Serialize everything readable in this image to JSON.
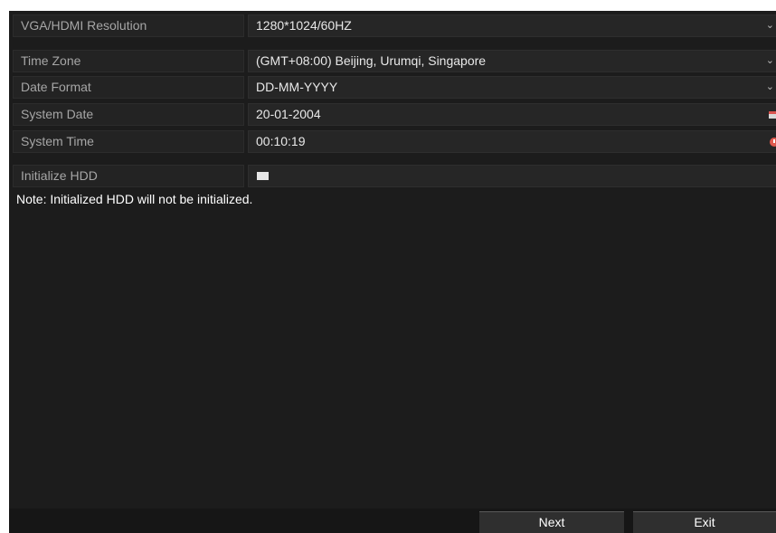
{
  "settings": {
    "resolution": {
      "label": "VGA/HDMI Resolution",
      "value": "1280*1024/60HZ"
    },
    "time_zone": {
      "label": "Time Zone",
      "value": "(GMT+08:00) Beijing, Urumqi, Singapore"
    },
    "date_format": {
      "label": "Date Format",
      "value": "DD-MM-YYYY"
    },
    "system_date": {
      "label": "System Date",
      "value": "20-01-2004"
    },
    "system_time": {
      "label": "System Time",
      "value": "00:10:19"
    },
    "initialize_hdd": {
      "label": "Initialize HDD",
      "checked": false
    }
  },
  "note": "Note: Initialized HDD will not be initialized.",
  "buttons": {
    "next": "Next",
    "exit": "Exit"
  },
  "icons": {
    "dropdown": "chevron-down-icon",
    "date": "calendar-icon",
    "time": "clock-icon"
  },
  "colors": {
    "background": "#1c1c1c",
    "label_text": "#a6a6a6",
    "value_text": "#e8e8e8",
    "icon_accent": "#e05a4f"
  }
}
